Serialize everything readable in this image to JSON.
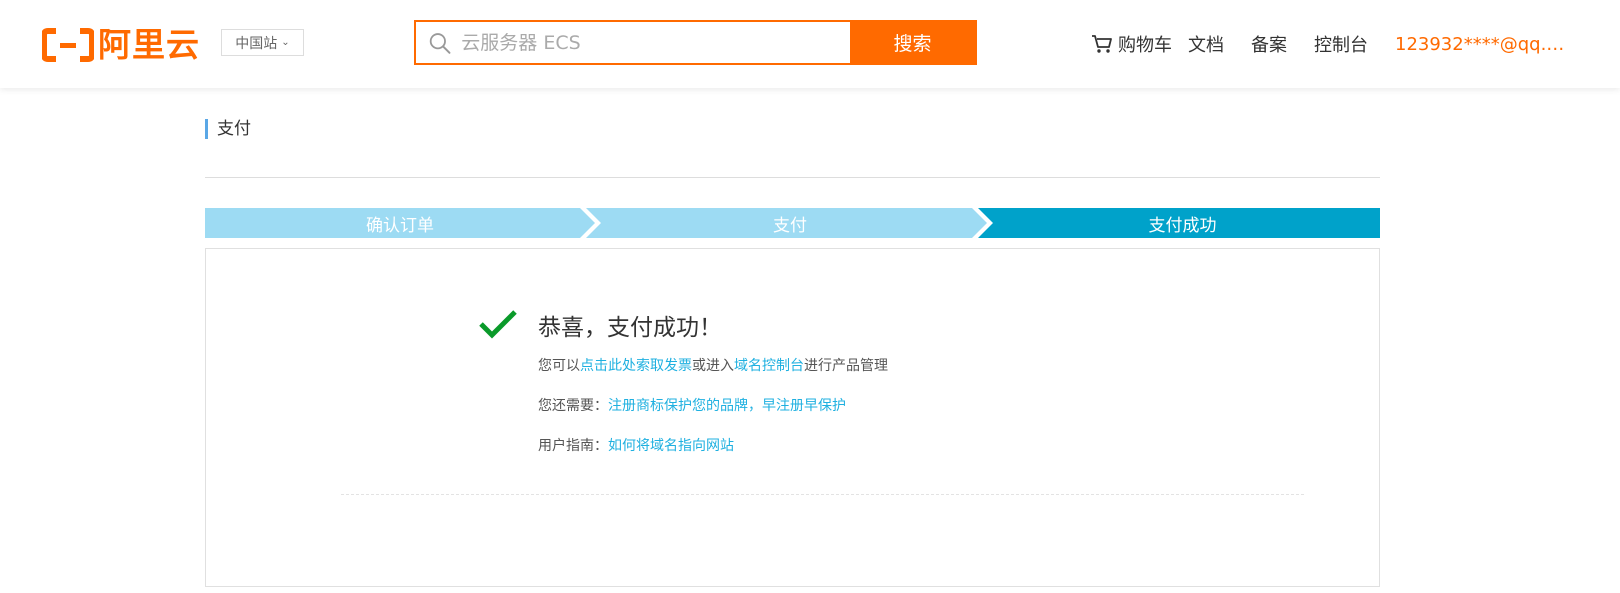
{
  "header": {
    "logo_text": "阿里云",
    "region": "中国站",
    "search": {
      "placeholder": "云服务器 ECS",
      "button": "搜索"
    },
    "nav": {
      "cart": "购物车",
      "docs": "文档",
      "beian": "备案",
      "console": "控制台",
      "user": "123932****@qq.…"
    }
  },
  "page": {
    "section_title": "支付",
    "steps": [
      {
        "label": "确认订单",
        "color": "#9ddbf3"
      },
      {
        "label": "支付",
        "color": "#9ddbf3"
      },
      {
        "label": "支付成功",
        "color": "#00a2ca"
      }
    ],
    "success": {
      "title": "恭喜，支付成功！",
      "line1": {
        "prefix": "您可以",
        "link1": "点击此处索取发票",
        "mid": "或进入",
        "link2": "域名控制台",
        "suffix": "进行产品管理"
      },
      "line2": {
        "prefix": "您还需要：",
        "link": "注册商标保护您的品牌，早注册早保护"
      },
      "line3": {
        "prefix": "用户指南：",
        "link": "如何将域名指向网站"
      }
    }
  },
  "colors": {
    "brand": "#ff6a00",
    "link": "#1fb0e0",
    "success_check": "#0a9a2a"
  }
}
